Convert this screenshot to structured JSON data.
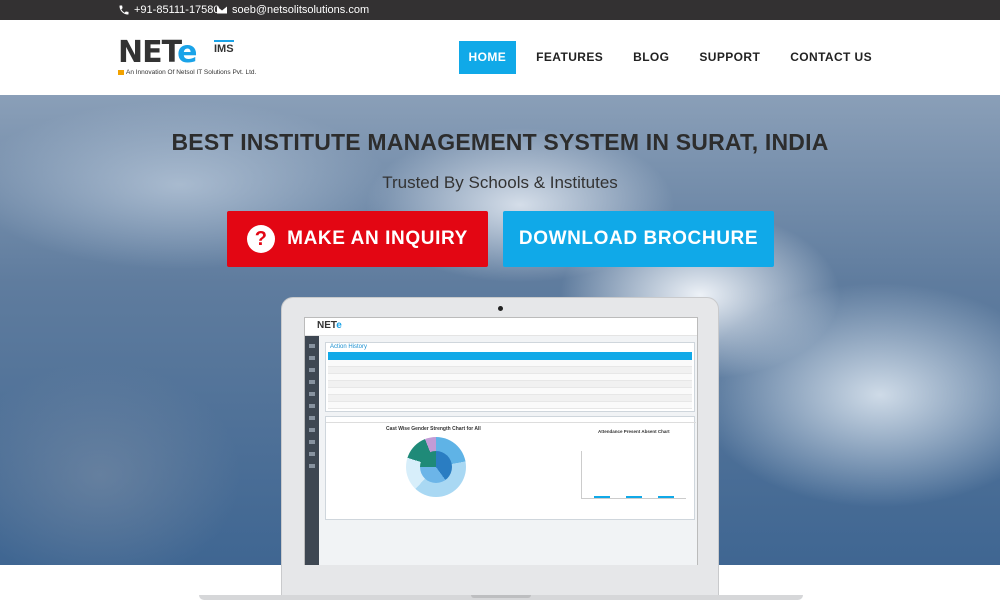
{
  "topbar": {
    "phone": "+91-85111-17580",
    "email": "soeb@netsolitsolutions.com"
  },
  "logo": {
    "mark_prefix": "NET",
    "mark_e": "e",
    "suffix": "IMS",
    "tagline": "An Innovation Of Netsol IT Solutions Pvt. Ltd."
  },
  "nav": {
    "items": [
      {
        "label": "HOME",
        "active": true
      },
      {
        "label": "FEATURES",
        "active": false
      },
      {
        "label": "BLOG",
        "active": false
      },
      {
        "label": "SUPPORT",
        "active": false
      },
      {
        "label": "CONTACT US",
        "active": false
      }
    ]
  },
  "hero": {
    "title": "BEST INSTITUTE MANAGEMENT SYSTEM IN SURAT, INDIA",
    "subtitle": "Trusted By Schools & Institutes",
    "inquiry_label": "MAKE AN INQUIRY",
    "brochure_label": "DOWNLOAD BROCHURE"
  },
  "screen": {
    "logo_prefix": "NET",
    "logo_e": "e",
    "panel1_title": "Action History",
    "pie_title": "Cast Wise Gender Strength Chart for All",
    "bar_title": "Attendance Present Absent Chart"
  },
  "colors": {
    "accent": "#10a9e8",
    "inquiry": "#e30613",
    "topbar": "#333132"
  }
}
